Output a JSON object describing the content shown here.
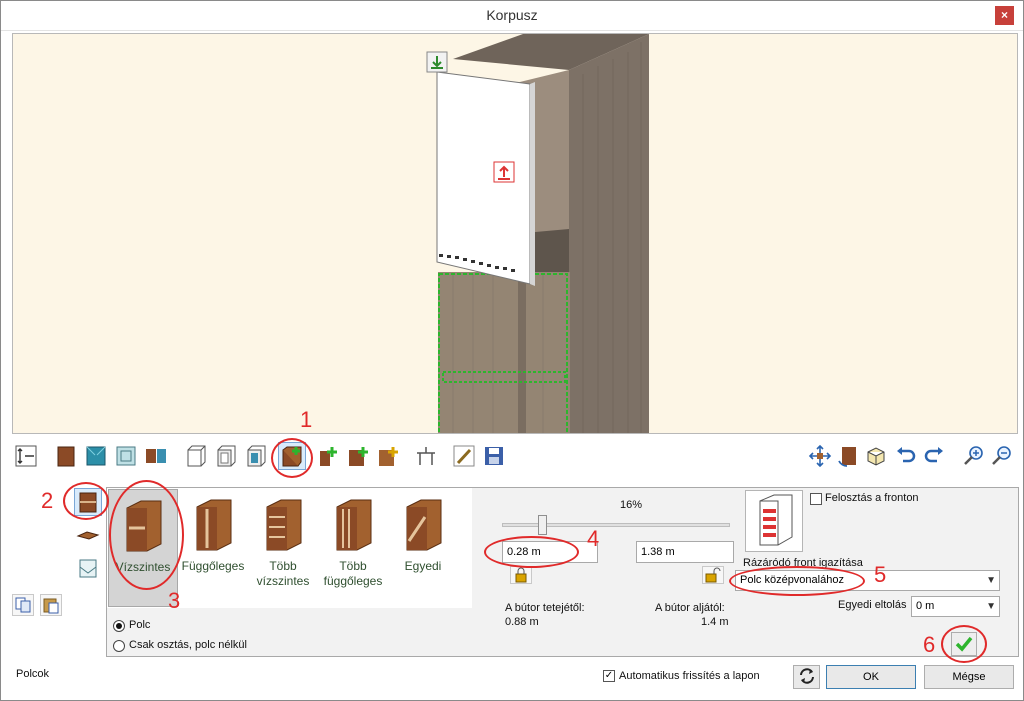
{
  "window": {
    "title": "Korpusz",
    "close_glyph": "×"
  },
  "panel": {
    "shelf_types": [
      {
        "label": "Vízszintes",
        "icon": "horizontal-shelf-icon"
      },
      {
        "label": "Függőleges",
        "icon": "vertical-divider-icon"
      },
      {
        "label": "Több vízszintes",
        "icon": "multi-horizontal-shelf-icon"
      },
      {
        "label": "Több függőleges",
        "icon": "multi-vertical-divider-icon"
      },
      {
        "label": "Egyedi",
        "icon": "custom-shelf-icon"
      }
    ],
    "radio_options": [
      {
        "label": "Polc",
        "checked": true
      },
      {
        "label": "Csak osztás, polc nélkül",
        "checked": false
      }
    ],
    "slider": {
      "percent_label": "16%",
      "value_fraction": 0.16
    },
    "top_offset_value": "0.28 m",
    "bottom_offset_value": "1.38 m",
    "from_top_label": "A bútor tetejétől:",
    "from_top_value": "0.88 m",
    "from_bottom_label": "A bútor aljától:",
    "from_bottom_value": "1.4 m",
    "split_on_front_label": "Felosztás a fronton",
    "split_on_front_checked": false,
    "closing_front_label": "Rázáródó front igazítása",
    "closing_front_value": "Polc középvonalához",
    "custom_offset_label": "Egyedi eltolás",
    "custom_offset_value": "0 m"
  },
  "status": {
    "section_label": "Polcok"
  },
  "footer": {
    "auto_refresh_label": "Automatikus frissítés a lapon",
    "auto_refresh_checked": true,
    "ok_label": "OK",
    "cancel_label": "Mégse"
  },
  "annotations": [
    "1",
    "2",
    "3",
    "4",
    "5",
    "6"
  ],
  "colors": {
    "viewport_bg": "#fdf6e6",
    "wood": "#8a7a6c",
    "annotation": "#e02a2a",
    "selection_green": "#2db52d"
  }
}
